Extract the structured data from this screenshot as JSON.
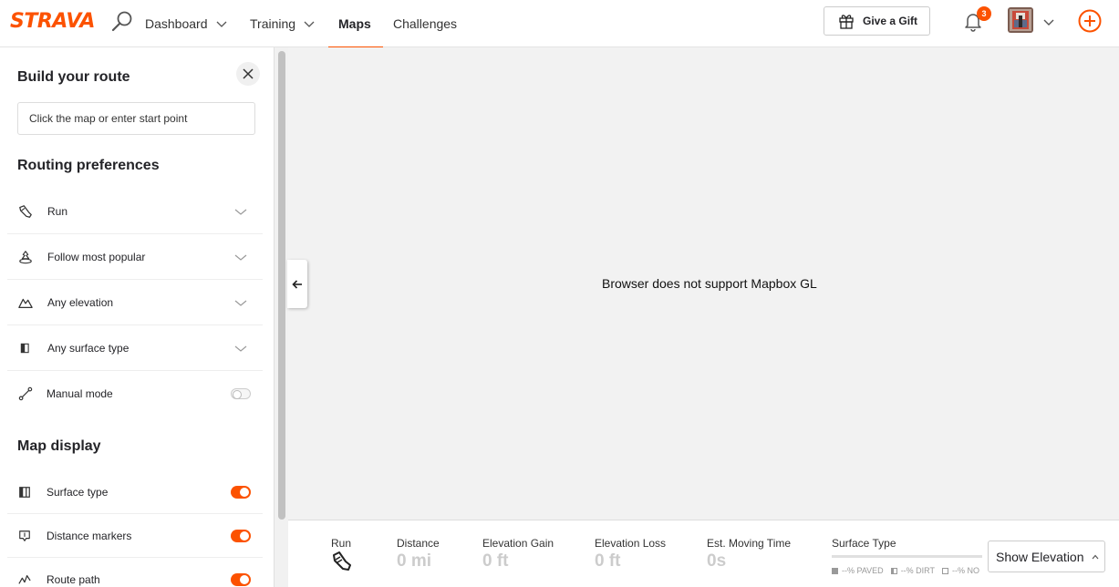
{
  "header": {
    "logo": "STRAVA",
    "nav": [
      {
        "label": "Dashboard",
        "dropdown": true
      },
      {
        "label": "Training",
        "dropdown": true
      },
      {
        "label": "Maps",
        "dropdown": false,
        "active": true
      },
      {
        "label": "Challenges",
        "dropdown": false
      }
    ],
    "gift_label": "Give a Gift",
    "notification_count": "3",
    "accent_color": "#fc5200"
  },
  "sidebar": {
    "title": "Build your route",
    "start_placeholder": "Click the map or enter start point",
    "routing_title": "Routing preferences",
    "routing": [
      {
        "icon": "shoe-icon",
        "label": "Run"
      },
      {
        "icon": "popular-icon",
        "label": "Follow most popular"
      },
      {
        "icon": "elevation-icon",
        "label": "Any elevation"
      },
      {
        "icon": "surface-icon",
        "label": "Any surface type"
      }
    ],
    "manual_mode_label": "Manual mode",
    "manual_mode_on": false,
    "display_title": "Map display",
    "display": [
      {
        "icon": "surface-type-icon",
        "label": "Surface type",
        "on": true
      },
      {
        "icon": "distance-marker-icon",
        "label": "Distance markers",
        "on": true
      },
      {
        "icon": "route-path-icon",
        "label": "Route path",
        "on": true
      }
    ]
  },
  "map": {
    "message": "Browser does not support Mapbox GL"
  },
  "footer": {
    "activity_label": "Run",
    "stats": [
      {
        "label": "Distance",
        "value": "0 mi"
      },
      {
        "label": "Elevation Gain",
        "value": "0 ft"
      },
      {
        "label": "Elevation Loss",
        "value": "0 ft"
      },
      {
        "label": "Est. Moving Time",
        "value": "0s"
      }
    ],
    "surface_label": "Surface Type",
    "surface_legend": [
      {
        "label": "--% PAVED"
      },
      {
        "label": "--% DIRT"
      },
      {
        "label": "--% NO"
      }
    ],
    "show_elevation_label": "Show Elevation"
  }
}
